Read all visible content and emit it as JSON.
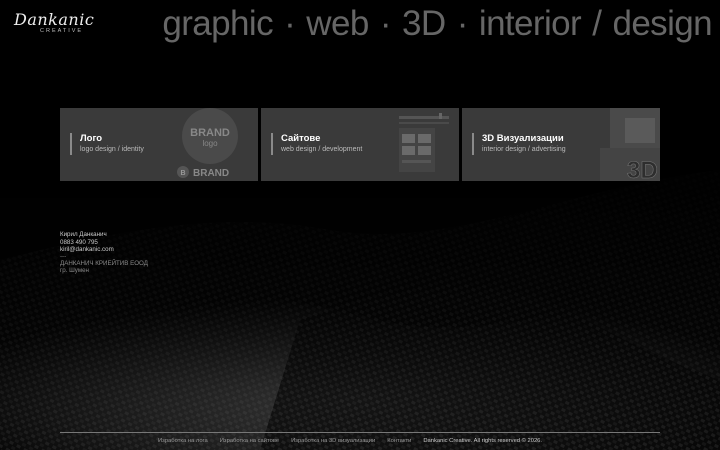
{
  "brand": {
    "name": "Dankanic",
    "subtitle": "CREATIVE"
  },
  "tagline": {
    "words": [
      "graphic",
      "web",
      "3D",
      "interior",
      "design"
    ],
    "sep_dot": "·",
    "sep_slash": "/"
  },
  "cards": [
    {
      "title": "Лого",
      "subtitle": "logo design / identity",
      "art_text_1": "BRAND",
      "art_text_2": "logo",
      "art_text_3": "BRAND",
      "art_badge": "B"
    },
    {
      "title": "Сайтове",
      "subtitle": "web design / development"
    },
    {
      "title": "3D Визуализации",
      "subtitle": "interior design / advertising",
      "art_text": "3D"
    }
  ],
  "contact": {
    "name": "Кирил Данканич",
    "phone": "0883 490 795",
    "email": "kiril@dankanic.com",
    "separator": "---",
    "company": "ДАНКАНИЧ КРИЕЙТИВ ЕООД",
    "city": "гр. Шумен"
  },
  "footer": {
    "links": [
      "Изработка на лога",
      "Изработка на сайтове",
      "Изработка на 3D визуализации",
      "Контакти"
    ],
    "copyright": "Dankanic Creative. All rights reserved © 2026."
  },
  "colors": {
    "background": "#050505",
    "card": "#3a3a3a",
    "tagline": "#666666",
    "accent_bar": "#8a8a8a"
  }
}
